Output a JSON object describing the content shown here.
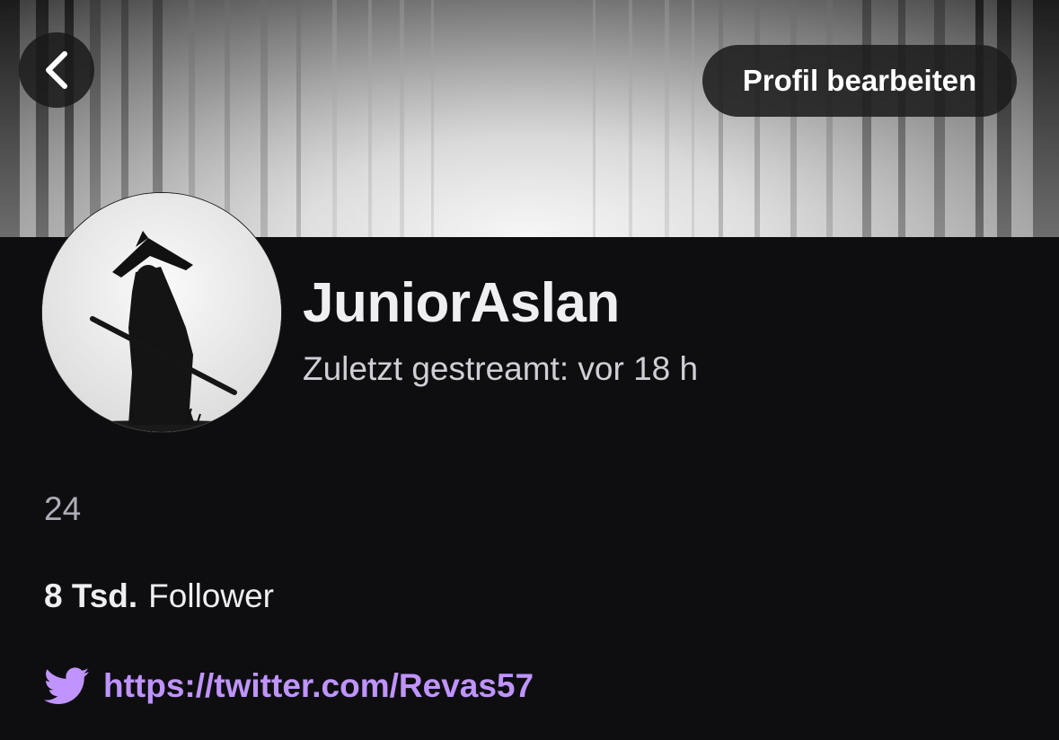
{
  "header": {
    "edit_button_label": "Profil bearbeiten"
  },
  "profile": {
    "username": "JuniorAslan",
    "last_streamed": "Zuletzt gestreamt: vor 18 h",
    "bio": "24",
    "followers_count": "8 Tsd.",
    "followers_label": "Follower"
  },
  "social_links": [
    {
      "icon": "twitter-icon",
      "url": "https://twitter.com/Revas57"
    }
  ],
  "colors": {
    "background": "#0e0e10",
    "link": "#bf94ff",
    "accent_purple": "#9147ff"
  }
}
